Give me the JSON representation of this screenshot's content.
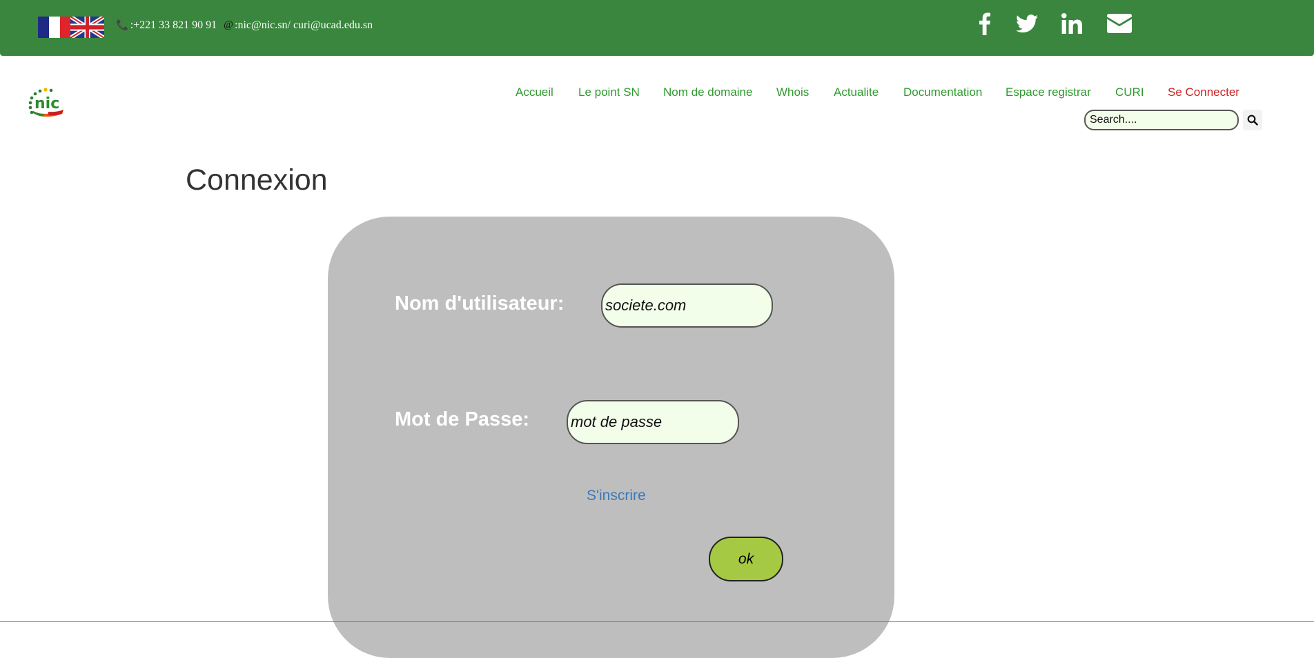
{
  "topbar": {
    "languages": [
      {
        "name": "fr-flag-icon",
        "label": "Français"
      },
      {
        "name": "uk-flag-icon",
        "label": "English"
      }
    ],
    "phone_prefix": ": ",
    "phone": "+221 33 821 90 91",
    "email_prefix": ": ",
    "email": "nic@nic.sn/ curi@ucad.edu.sn",
    "social": [
      "facebook-icon",
      "twitter-icon",
      "linkedin-icon",
      "mail-icon"
    ],
    "bg_color": "#3a863e"
  },
  "nav": {
    "items": [
      {
        "label": "Accueil"
      },
      {
        "label": "Le point SN"
      },
      {
        "label": "Nom de domaine"
      },
      {
        "label": "Whois"
      },
      {
        "label": "Actualite"
      },
      {
        "label": "Documentation"
      },
      {
        "label": "Espace registrar"
      },
      {
        "label": "CURI"
      },
      {
        "label": "Se Connecter"
      }
    ],
    "link_color": "#2e9a2e",
    "active_color": "#cc2222",
    "search_placeholder": "Search...."
  },
  "page": {
    "title": "Connexion"
  },
  "login": {
    "username_label": "Nom d'utilisateur:",
    "username_placeholder": "societe.com",
    "password_label": "Mot de Passe:",
    "password_placeholder": "mot de passe",
    "register_link": "S'inscrire",
    "submit_label": "ok",
    "panel_color": "#bebebe",
    "button_color": "#a6c943"
  }
}
